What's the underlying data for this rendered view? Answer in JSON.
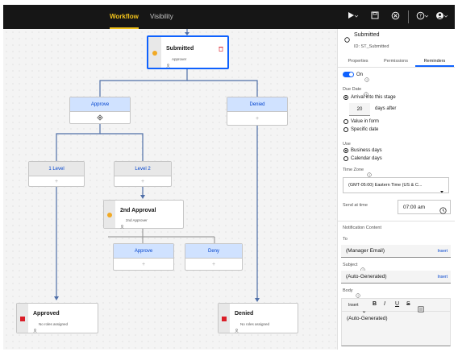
{
  "topbar": {
    "tabs": [
      {
        "label": "Workflow",
        "active": true
      },
      {
        "label": "Visibility",
        "active": false
      }
    ],
    "icons": [
      "play-icon",
      "chevron-down-icon",
      "save-icon",
      "cancel-icon",
      "help-icon",
      "chevron-down-icon",
      "user-icon",
      "chevron-down-icon"
    ],
    "colors": {
      "bg": "#161616",
      "accent": "#f1c21b"
    }
  },
  "canvas": {
    "nodes": {
      "submitted": {
        "title": "Submitted",
        "assignee": "Approver",
        "icons": [
          "user-icon",
          "trash-icon"
        ]
      },
      "approval2": {
        "title": "2nd Approval",
        "assignee": "2nd Approver"
      },
      "approved": {
        "title": "Approved",
        "assignee": "No roles assigned"
      },
      "denied": {
        "title": "Denied",
        "assignee": "No roles assigned"
      }
    },
    "branches": {
      "approve": {
        "label": "Approve",
        "icon": "diamond-icon"
      },
      "denied": {
        "label": "Denied",
        "add": "+"
      },
      "level1": {
        "label": "1 Level",
        "add": "+"
      },
      "level2": {
        "label": "Level 2",
        "add": "+"
      },
      "approve2": {
        "label": "Approve",
        "add": "+"
      },
      "deny": {
        "label": "Deny",
        "add": "+"
      }
    },
    "colors": {
      "connector": "#4f6fa8",
      "link": "#0043ce",
      "header": "#d0e2ff",
      "pending": "#f1a924",
      "end": "#da1e28"
    }
  },
  "panel": {
    "stage_name": "Submitted",
    "stage_id": "ID: ST_Submitted",
    "tabs": [
      {
        "label": "Properties",
        "active": false
      },
      {
        "label": "Permissions",
        "active": false
      },
      {
        "label": "Reminders",
        "active": true
      }
    ],
    "toggle": {
      "label": "On",
      "on": true
    },
    "due_date": {
      "label": "Due Date",
      "options": [
        {
          "label": "Arrival into this stage",
          "selected": true
        },
        {
          "label": "Value in form",
          "selected": false
        },
        {
          "label": "Specific date",
          "selected": false
        }
      ],
      "days_value": "20",
      "days_suffix": "days after"
    },
    "use": {
      "label": "Use",
      "options": [
        {
          "label": "Business days",
          "selected": true
        },
        {
          "label": "Calendar days",
          "selected": false
        }
      ]
    },
    "time_zone": {
      "label": "Time Zone",
      "value": "(GMT-05:00) Eastern Time (US & C..."
    },
    "send_at": {
      "label": "Send at time",
      "value": "07:00 am"
    },
    "notification": {
      "label": "Notification Content",
      "to_label": "To",
      "to_value": "(Manager Email)",
      "subject_label": "Subject",
      "subject_value": "(Auto-Generated)",
      "insert": "Insert",
      "body_label": "Body",
      "body_insert": "Insert",
      "body_value": "(Auto-Generated)",
      "format_buttons": [
        "B",
        "I",
        "U",
        "S"
      ]
    },
    "colors": {
      "accent": "#0f62fe",
      "link": "#0043ce"
    }
  }
}
